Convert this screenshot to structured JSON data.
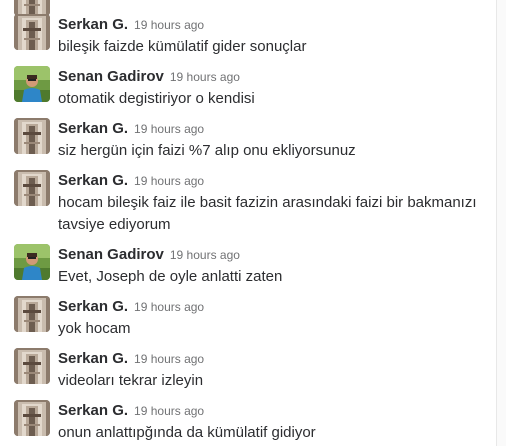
{
  "messages": [
    {
      "author": "Serkan G.",
      "time": "19 hours ago",
      "text": "bileşik faizde kümülatif gider sonuçlar",
      "avatar": "serkan-avatar"
    },
    {
      "author": "Senan Gadirov",
      "time": "19 hours ago",
      "text": "otomatik degistiriyor o kendisi",
      "avatar": "senan-avatar"
    },
    {
      "author": "Serkan G.",
      "time": "19 hours ago",
      "text": "siz hergün için faizi %7 alıp onu ekliyorsunuz",
      "avatar": "serkan-avatar"
    },
    {
      "author": "Serkan G.",
      "time": "19 hours ago",
      "text": "hocam bileşik faiz ile basit fazizin arasındaki faizi bir bakmanızı tavsiye ediyorum",
      "avatar": "serkan-avatar"
    },
    {
      "author": "Senan Gadirov",
      "time": "19 hours ago",
      "text": "Evet, Joseph de oyle anlatti zaten",
      "avatar": "senan-avatar"
    },
    {
      "author": "Serkan G.",
      "time": "19 hours ago",
      "text": "yok hocam",
      "avatar": "serkan-avatar"
    },
    {
      "author": "Serkan G.",
      "time": "19 hours ago",
      "text": "videoları tekrar izleyin",
      "avatar": "serkan-avatar"
    },
    {
      "author": "Serkan G.",
      "time": "19 hours ago",
      "text": "onun anlattıpğında da kümülatif gidiyor",
      "avatar": "serkan-avatar"
    }
  ]
}
